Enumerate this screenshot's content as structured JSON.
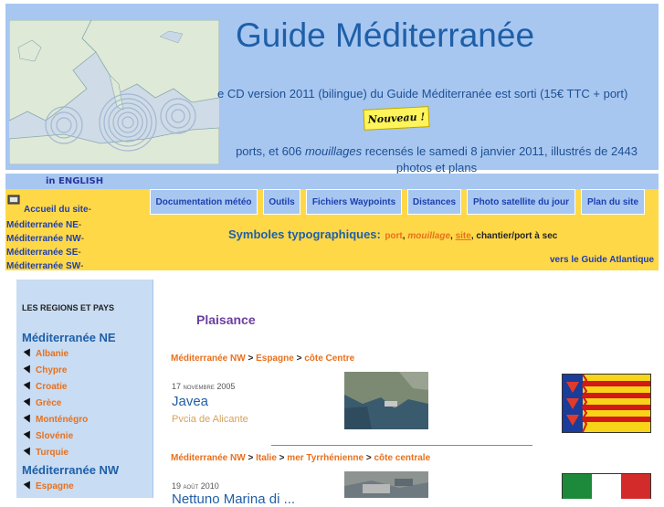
{
  "header": {
    "title": "Guide Méditerranée",
    "cd_announcement": "e CD version 2011 (bilingue) du Guide Méditerranée est sorti (15€ TTC + port)",
    "nouveau_badge": "Nouveau !",
    "stats_prefix": "ports, et 606 ",
    "stats_mouillages": "mouillages",
    "stats_middle": " recensés le samedi 8 janvier 2011, illustrés de 2443",
    "stats_line2": "photos et plans"
  },
  "nav": {
    "english": "in ENGLISH",
    "links": [
      {
        "label": "Accueil du site"
      },
      {
        "label": "Méditerranée NE"
      },
      {
        "label": "Méditerranée NW"
      },
      {
        "label": "Méditerranée SE"
      },
      {
        "label": "Méditerranée SW"
      }
    ],
    "separator": "-",
    "tabs": [
      {
        "label": "Documentation météo"
      },
      {
        "label": "Outils"
      },
      {
        "label": "Fichiers Waypoints"
      },
      {
        "label": "Distances"
      },
      {
        "label": "Photo satellite du jour"
      },
      {
        "label": "Plan du site"
      }
    ],
    "symbols_label": "Symboles typographiques:",
    "symbols": {
      "port": "port",
      "sep1": ", ",
      "mouillage": "mouillage",
      "sep2": ", ",
      "site": "site",
      "sep3": ", ",
      "chantier": "chantier/port à sec"
    },
    "atlantic_link": "vers le Guide Atlantique"
  },
  "sidebar": {
    "heading": "LES REGIONS ET PAYS",
    "regions": [
      {
        "name": "Méditerranée NE",
        "countries": [
          "Albanie",
          "Chypre",
          "Croatie",
          "Grèce",
          "Monténégro",
          "Slovénie",
          "Turquie"
        ]
      },
      {
        "name": "Méditerranée NW",
        "countries": [
          "Espagne"
        ]
      }
    ]
  },
  "main": {
    "section_title": "Plaisance",
    "entries": [
      {
        "breadcrumb": [
          "Méditerranée NW",
          "Espagne",
          "côte Centre"
        ],
        "date_day": "17",
        "date_month": "novembre",
        "date_year": "2005",
        "title": "Javea",
        "subtitle": "Pvcia de Alicante"
      },
      {
        "breadcrumb": [
          "Méditerranée NW",
          "Italie",
          "mer Tyrrhénienne",
          "côte centrale"
        ],
        "date_day": "19",
        "date_month": "août",
        "date_year": "2010",
        "title": "Nettuno Marina di ...",
        "subtitle": ""
      }
    ],
    "crumb_separator": ">"
  },
  "colors": {
    "header_bg": "#a7c7f1",
    "nav_yellow": "#ffd848",
    "title_blue": "#1f5fa8",
    "link_blue": "#1d3fb0",
    "link_orange": "#e9701c",
    "plaisance_purple": "#6a3fa2"
  }
}
